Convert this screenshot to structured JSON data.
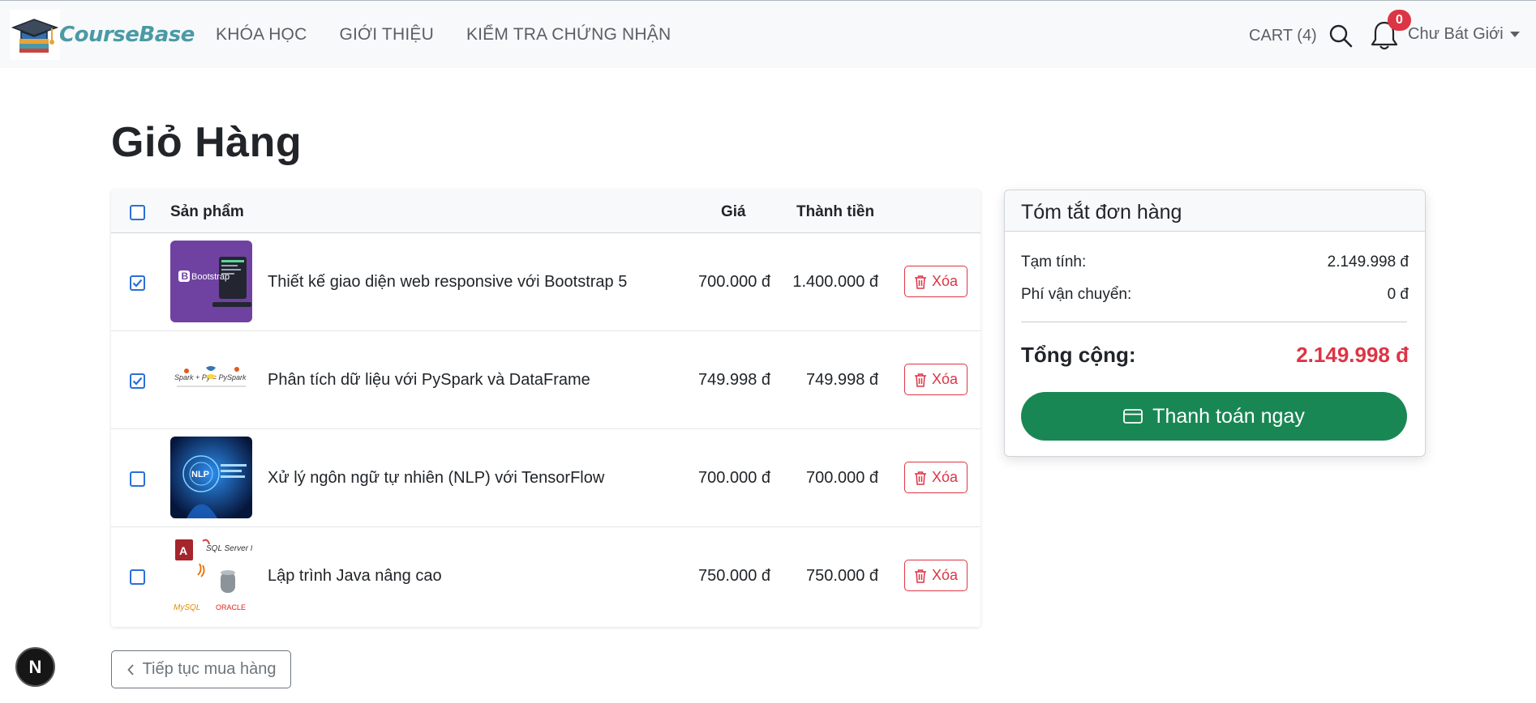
{
  "brand": {
    "name": "CourseBase"
  },
  "nav": {
    "items": [
      "KHÓA HỌC",
      "GIỚI THIỆU",
      "KIỂM TRA CHỨNG NHẬN"
    ]
  },
  "header": {
    "cart_label": "CART (4)",
    "notification_count": "0",
    "user_name": "Chư Bát Giới",
    "icons": [
      "search-icon",
      "bell-icon",
      "caret-down-icon"
    ]
  },
  "page": {
    "title": "Giỏ Hàng"
  },
  "cart": {
    "columns": {
      "product": "Sản phẩm",
      "price": "Giá",
      "total": "Thành tiền"
    },
    "select_all_checked": false,
    "items": [
      {
        "checked": true,
        "name": "Thiết kế giao diện web responsive với Bootstrap 5",
        "price": "700.000 đ",
        "total": "1.400.000 đ",
        "delete_label": "Xóa",
        "thumb_text": "Bootstrap"
      },
      {
        "checked": true,
        "name": "Phân tích dữ liệu với PySpark và DataFrame",
        "price": "749.998 đ",
        "total": "749.998 đ",
        "delete_label": "Xóa",
        "thumb_text": "Spark + Py = PySpark"
      },
      {
        "checked": false,
        "name": "Xử lý ngôn ngữ tự nhiên (NLP) với TensorFlow",
        "price": "700.000 đ",
        "total": "700.000 đ",
        "delete_label": "Xóa",
        "thumb_text": "NLP"
      },
      {
        "checked": false,
        "name": "Lập trình Java nâng cao",
        "price": "750.000 đ",
        "total": "750.000 đ",
        "delete_label": "Xóa",
        "thumb_text": "SQL Server MySQL ORACLE"
      }
    ]
  },
  "summary": {
    "title": "Tóm tắt đơn hàng",
    "subtotal_label": "Tạm tính:",
    "subtotal_value": "2.149.998 đ",
    "shipping_label": "Phí vận chuyển:",
    "shipping_value": "0 đ",
    "grand_label": "Tổng cộng:",
    "grand_value": "2.149.998 đ",
    "pay_label": "Thanh toán ngay"
  },
  "footer": {
    "continue_label": "Tiếp tục mua hàng",
    "dev_badge": "N"
  },
  "colors": {
    "danger": "#dc3545",
    "success": "#198754",
    "primary": "#2a6fd8",
    "brand": "#4a9aa6"
  }
}
